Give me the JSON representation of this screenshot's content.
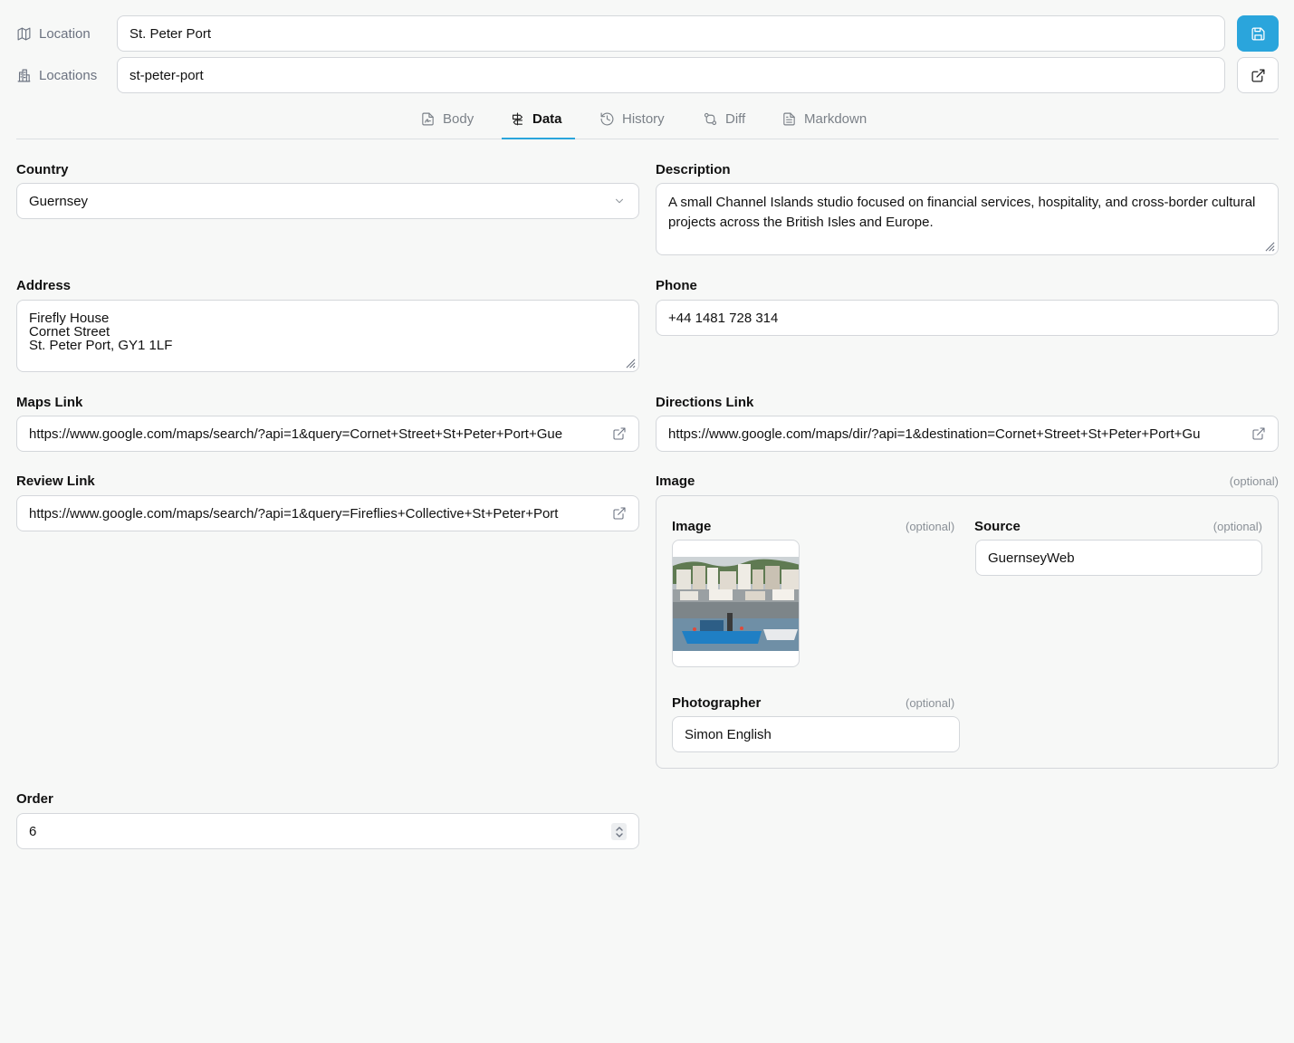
{
  "header": {
    "location_label": "Location",
    "location_value": "St. Peter Port",
    "locations_label": "Locations",
    "slug_value": "st-peter-port"
  },
  "tabs": [
    {
      "label": "Body",
      "icon": "file-signature-icon"
    },
    {
      "label": "Data",
      "icon": "signpost-icon"
    },
    {
      "label": "History",
      "icon": "history-icon"
    },
    {
      "label": "Diff",
      "icon": "git-compare-icon"
    },
    {
      "label": "Markdown",
      "icon": "file-text-icon"
    }
  ],
  "active_tab": "Data",
  "colors": {
    "accent": "#2aa5dc"
  },
  "form": {
    "country": {
      "label": "Country",
      "value": "Guernsey"
    },
    "description": {
      "label": "Description",
      "value": "A small Channel Islands studio focused on financial services, hospitality, and cross-border cultural projects across the British Isles and Europe."
    },
    "address": {
      "label": "Address",
      "line1": "Firefly House",
      "line2": "Cornet Street",
      "line3": "St. Peter Port, GY1 1LF"
    },
    "phone": {
      "label": "Phone",
      "value": "+44 1481 728 314"
    },
    "maps_link": {
      "label": "Maps Link",
      "value": "https://www.google.com/maps/search/?api=1&query=Cornet+Street+St+Peter+Port+Gue"
    },
    "directions_link": {
      "label": "Directions Link",
      "value": "https://www.google.com/maps/dir/?api=1&destination=Cornet+Street+St+Peter+Port+Gu"
    },
    "review_link": {
      "label": "Review Link",
      "value": "https://www.google.com/maps/search/?api=1&query=Fireflies+Collective+St+Peter+Port"
    },
    "image_group": {
      "label": "Image",
      "optional": "(optional)",
      "image": {
        "label": "Image",
        "optional": "(optional)"
      },
      "source": {
        "label": "Source",
        "optional": "(optional)",
        "value": "GuernseyWeb"
      },
      "photographer": {
        "label": "Photographer",
        "optional": "(optional)",
        "value": "Simon English"
      }
    },
    "order": {
      "label": "Order",
      "value": "6"
    }
  }
}
